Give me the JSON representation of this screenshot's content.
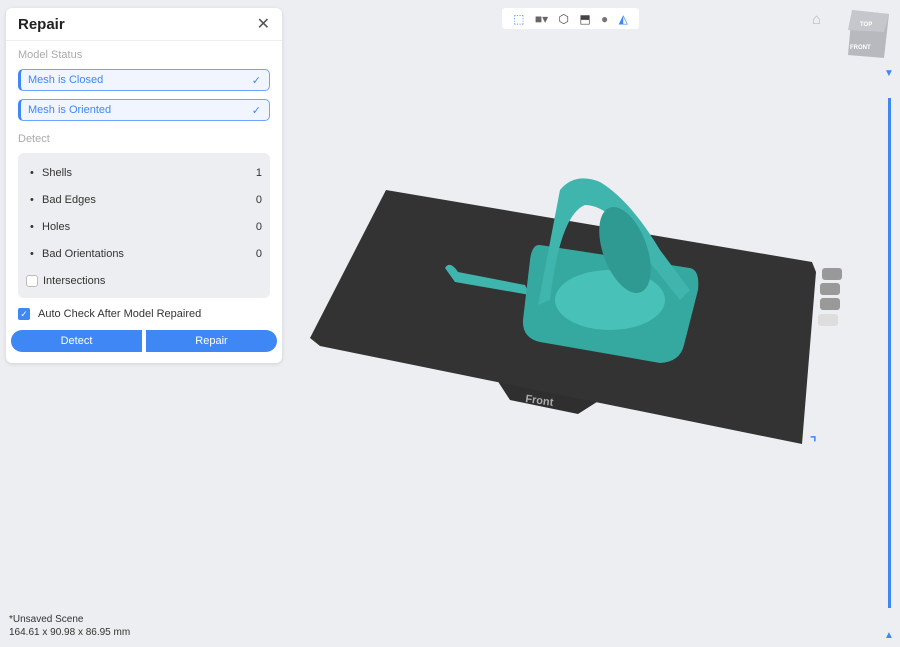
{
  "panel": {
    "title": "Repair",
    "model_status_label": "Model Status",
    "status": [
      {
        "label": "Mesh is Closed"
      },
      {
        "label": "Mesh is Oriented"
      }
    ],
    "detect_label": "Detect",
    "items": [
      {
        "label": "Shells",
        "value": "1"
      },
      {
        "label": "Bad Edges",
        "value": "0"
      },
      {
        "label": "Holes",
        "value": "0"
      },
      {
        "label": "Bad Orientations",
        "value": "0"
      }
    ],
    "intersections_label": "Intersections",
    "auto_check_label": "Auto Check After Model Repaired",
    "detect_button": "Detect",
    "repair_button": "Repair"
  },
  "viewport": {
    "plate_label": "Front",
    "cube_top": "TOP",
    "cube_front": "FRONT"
  },
  "footer": {
    "scene": "*Unsaved Scene",
    "dimensions": "164.61 x 90.98 x 86.95 mm"
  },
  "colors": {
    "accent": "#3f87f5",
    "model": "#3fb5ad",
    "plate": "#333333"
  }
}
